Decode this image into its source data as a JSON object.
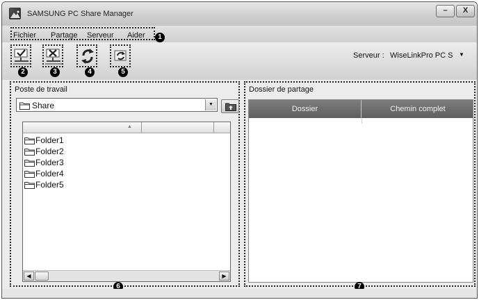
{
  "window": {
    "title": "SAMSUNG PC Share Manager",
    "minimize_label": "–",
    "close_label": "X"
  },
  "menu": {
    "items": [
      {
        "label": "Fichier"
      },
      {
        "label": "Partage"
      },
      {
        "label": "Serveur"
      },
      {
        "label": "Aider"
      }
    ]
  },
  "toolbar": {
    "buttons": [
      {
        "icon": "share-folder-check-icon"
      },
      {
        "icon": "unshare-folder-x-icon"
      },
      {
        "icon": "refresh-icon"
      },
      {
        "icon": "sync-server-icon"
      }
    ],
    "server_label": "Serveur :",
    "server_value": "WiseLinkPro PC Se"
  },
  "callouts": [
    "1",
    "2",
    "3",
    "4",
    "5",
    "6",
    "7"
  ],
  "left_panel": {
    "title": "Poste de travail",
    "path_value": "Share",
    "folders": [
      {
        "name": "Folder1"
      },
      {
        "name": "Folder2"
      },
      {
        "name": "Folder3"
      },
      {
        "name": "Folder4"
      },
      {
        "name": "Folder5"
      }
    ]
  },
  "right_panel": {
    "title": "Dossier de partage",
    "columns": [
      {
        "label": "Dossier"
      },
      {
        "label": "Chemin complet"
      }
    ]
  }
}
